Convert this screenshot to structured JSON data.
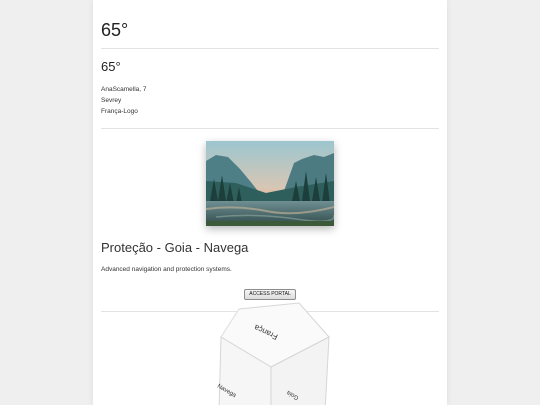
{
  "header": {
    "temperature": "65°"
  },
  "weather": {
    "temperature": "65°",
    "address_lines": [
      "AnaScamella, 7",
      "Sevrey",
      "França-Logo"
    ]
  },
  "hero_image": {
    "alt": "mountain valley landscape at sunset"
  },
  "section": {
    "title": "Proteção - Goia - Navega",
    "description": "Advanced navigation and protection systems.",
    "button_label": "ACCESS PORTAL"
  },
  "cube": {
    "top_face_label": "França",
    "left_face_label": "Navega",
    "right_face_label": "Goia"
  }
}
